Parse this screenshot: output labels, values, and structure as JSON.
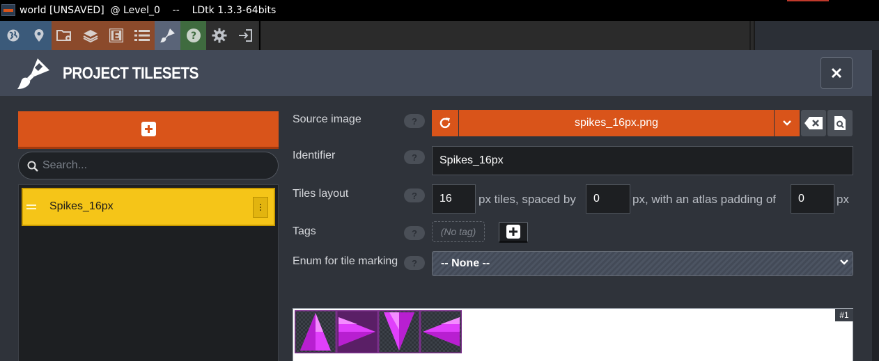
{
  "window": {
    "title": "world [UNSAVED]  @ Level_0    --    LDtk 1.3.3-64bits"
  },
  "toolbar": {
    "buttons": [
      {
        "name": "world-icon",
        "color": "#3b5a7a"
      },
      {
        "name": "location-pin-icon",
        "color": "#3b5a7a"
      },
      {
        "name": "project-folder-icon",
        "color": "#8b4a2b"
      },
      {
        "name": "layers-icon",
        "color": "#8b4a2b"
      },
      {
        "name": "entities-icon",
        "color": "#8b4a2b"
      },
      {
        "name": "enums-list-icon",
        "color": "#8b4a2b"
      },
      {
        "name": "tilesets-brush-icon",
        "color": "#5a6478"
      },
      {
        "name": "help-icon",
        "color": "#3f6b3f"
      },
      {
        "name": "settings-gear-icon",
        "color": "#2f2f2f"
      },
      {
        "name": "exit-icon",
        "color": "#2f2f2f"
      }
    ]
  },
  "modal": {
    "title": "PROJECT TILESETS",
    "close_icon": "close-icon"
  },
  "sidebar": {
    "add_icon": "plus-icon",
    "search_placeholder": "Search...",
    "items": [
      {
        "label": "Spikes_16px"
      }
    ]
  },
  "form": {
    "source_image": {
      "label": "Source image",
      "help": "?",
      "value": "spikes_16px.png"
    },
    "identifier": {
      "label": "Identifier",
      "help": "?",
      "value": "Spikes_16px"
    },
    "tiles_layout": {
      "label": "Tiles layout",
      "help": "?",
      "tile_size": "16",
      "text_after_size": "px tiles, spaced by",
      "spacing": "0",
      "text_after_spacing": "px, with an atlas padding of",
      "padding": "0",
      "text_after_padding": "px"
    },
    "tags": {
      "label": "Tags",
      "help": "?",
      "empty_text": "(No tag)"
    },
    "enum_marking": {
      "label": "Enum for tile marking",
      "help": "?",
      "value": "-- None --"
    }
  },
  "tileset_preview": {
    "badge": "#1",
    "tile_color": "#e040fb"
  },
  "colors": {
    "accent": "#d9541a",
    "selected_item": "#f5c518",
    "modal_bg": "#2f333a",
    "header_bg": "#424957"
  }
}
